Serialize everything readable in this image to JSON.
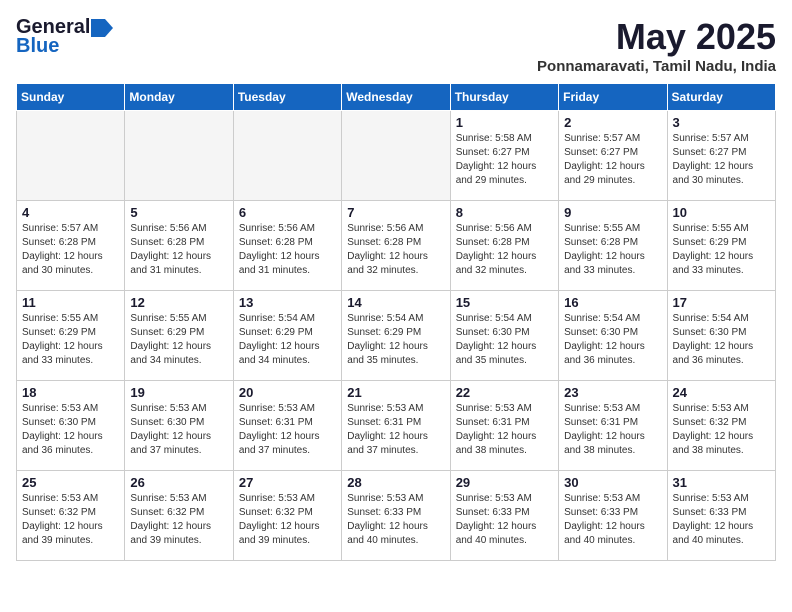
{
  "logo": {
    "line1": "General",
    "line2": "Blue"
  },
  "title": "May 2025",
  "location": "Ponnamaravati, Tamil Nadu, India",
  "days_of_week": [
    "Sunday",
    "Monday",
    "Tuesday",
    "Wednesday",
    "Thursday",
    "Friday",
    "Saturday"
  ],
  "weeks": [
    [
      {
        "day": "",
        "info": ""
      },
      {
        "day": "",
        "info": ""
      },
      {
        "day": "",
        "info": ""
      },
      {
        "day": "",
        "info": ""
      },
      {
        "day": "1",
        "info": "Sunrise: 5:58 AM\nSunset: 6:27 PM\nDaylight: 12 hours\nand 29 minutes."
      },
      {
        "day": "2",
        "info": "Sunrise: 5:57 AM\nSunset: 6:27 PM\nDaylight: 12 hours\nand 29 minutes."
      },
      {
        "day": "3",
        "info": "Sunrise: 5:57 AM\nSunset: 6:27 PM\nDaylight: 12 hours\nand 30 minutes."
      }
    ],
    [
      {
        "day": "4",
        "info": "Sunrise: 5:57 AM\nSunset: 6:28 PM\nDaylight: 12 hours\nand 30 minutes."
      },
      {
        "day": "5",
        "info": "Sunrise: 5:56 AM\nSunset: 6:28 PM\nDaylight: 12 hours\nand 31 minutes."
      },
      {
        "day": "6",
        "info": "Sunrise: 5:56 AM\nSunset: 6:28 PM\nDaylight: 12 hours\nand 31 minutes."
      },
      {
        "day": "7",
        "info": "Sunrise: 5:56 AM\nSunset: 6:28 PM\nDaylight: 12 hours\nand 32 minutes."
      },
      {
        "day": "8",
        "info": "Sunrise: 5:56 AM\nSunset: 6:28 PM\nDaylight: 12 hours\nand 32 minutes."
      },
      {
        "day": "9",
        "info": "Sunrise: 5:55 AM\nSunset: 6:28 PM\nDaylight: 12 hours\nand 33 minutes."
      },
      {
        "day": "10",
        "info": "Sunrise: 5:55 AM\nSunset: 6:29 PM\nDaylight: 12 hours\nand 33 minutes."
      }
    ],
    [
      {
        "day": "11",
        "info": "Sunrise: 5:55 AM\nSunset: 6:29 PM\nDaylight: 12 hours\nand 33 minutes."
      },
      {
        "day": "12",
        "info": "Sunrise: 5:55 AM\nSunset: 6:29 PM\nDaylight: 12 hours\nand 34 minutes."
      },
      {
        "day": "13",
        "info": "Sunrise: 5:54 AM\nSunset: 6:29 PM\nDaylight: 12 hours\nand 34 minutes."
      },
      {
        "day": "14",
        "info": "Sunrise: 5:54 AM\nSunset: 6:29 PM\nDaylight: 12 hours\nand 35 minutes."
      },
      {
        "day": "15",
        "info": "Sunrise: 5:54 AM\nSunset: 6:30 PM\nDaylight: 12 hours\nand 35 minutes."
      },
      {
        "day": "16",
        "info": "Sunrise: 5:54 AM\nSunset: 6:30 PM\nDaylight: 12 hours\nand 36 minutes."
      },
      {
        "day": "17",
        "info": "Sunrise: 5:54 AM\nSunset: 6:30 PM\nDaylight: 12 hours\nand 36 minutes."
      }
    ],
    [
      {
        "day": "18",
        "info": "Sunrise: 5:53 AM\nSunset: 6:30 PM\nDaylight: 12 hours\nand 36 minutes."
      },
      {
        "day": "19",
        "info": "Sunrise: 5:53 AM\nSunset: 6:30 PM\nDaylight: 12 hours\nand 37 minutes."
      },
      {
        "day": "20",
        "info": "Sunrise: 5:53 AM\nSunset: 6:31 PM\nDaylight: 12 hours\nand 37 minutes."
      },
      {
        "day": "21",
        "info": "Sunrise: 5:53 AM\nSunset: 6:31 PM\nDaylight: 12 hours\nand 37 minutes."
      },
      {
        "day": "22",
        "info": "Sunrise: 5:53 AM\nSunset: 6:31 PM\nDaylight: 12 hours\nand 38 minutes."
      },
      {
        "day": "23",
        "info": "Sunrise: 5:53 AM\nSunset: 6:31 PM\nDaylight: 12 hours\nand 38 minutes."
      },
      {
        "day": "24",
        "info": "Sunrise: 5:53 AM\nSunset: 6:32 PM\nDaylight: 12 hours\nand 38 minutes."
      }
    ],
    [
      {
        "day": "25",
        "info": "Sunrise: 5:53 AM\nSunset: 6:32 PM\nDaylight: 12 hours\nand 39 minutes."
      },
      {
        "day": "26",
        "info": "Sunrise: 5:53 AM\nSunset: 6:32 PM\nDaylight: 12 hours\nand 39 minutes."
      },
      {
        "day": "27",
        "info": "Sunrise: 5:53 AM\nSunset: 6:32 PM\nDaylight: 12 hours\nand 39 minutes."
      },
      {
        "day": "28",
        "info": "Sunrise: 5:53 AM\nSunset: 6:33 PM\nDaylight: 12 hours\nand 40 minutes."
      },
      {
        "day": "29",
        "info": "Sunrise: 5:53 AM\nSunset: 6:33 PM\nDaylight: 12 hours\nand 40 minutes."
      },
      {
        "day": "30",
        "info": "Sunrise: 5:53 AM\nSunset: 6:33 PM\nDaylight: 12 hours\nand 40 minutes."
      },
      {
        "day": "31",
        "info": "Sunrise: 5:53 AM\nSunset: 6:33 PM\nDaylight: 12 hours\nand 40 minutes."
      }
    ]
  ]
}
